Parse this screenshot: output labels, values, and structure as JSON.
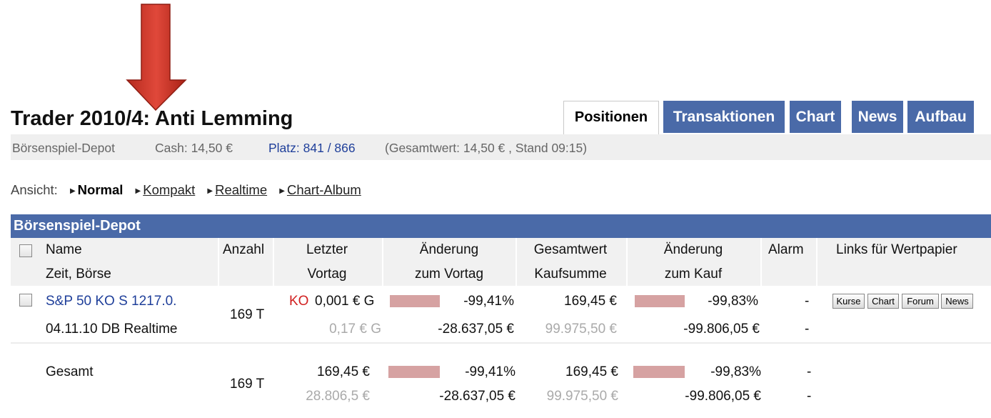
{
  "header": {
    "title": "Trader 2010/4: Anti Lemming",
    "tabs": [
      {
        "label": "Positionen",
        "active": true
      },
      {
        "label": "Transaktionen",
        "active": false
      },
      {
        "label": "Chart",
        "active": false
      },
      {
        "label": "News",
        "active": false
      },
      {
        "label": "Aufbau",
        "active": false
      }
    ]
  },
  "subbar": {
    "depot": "Börsenspiel-Depot",
    "cash": "Cash: 14,50 €",
    "platz": "Platz: 841 / 866",
    "gesamt": "(Gesamtwert: 14,50 € , Stand 09:15)"
  },
  "view": {
    "label": "Ansicht:",
    "options": [
      "Normal",
      "Kompakt",
      "Realtime",
      "Chart-Album"
    ],
    "selected": "Normal"
  },
  "table": {
    "title": "Börsenspiel-Depot",
    "headers": {
      "name": "Name",
      "zeit": "Zeit, Börse",
      "anzahl": "Anzahl",
      "letzter": "Letzter",
      "vortag": "Vortag",
      "aend_vortag_1": "Änderung",
      "aend_vortag_2": "zum Vortag",
      "gesamtwert": "Gesamtwert",
      "kaufsumme": "Kaufsumme",
      "aend_kauf_1": "Änderung",
      "aend_kauf_2": "zum Kauf",
      "alarm": "Alarm",
      "links": "Links für Wertpapier"
    },
    "position": {
      "name": "S&P 50 KO S 1217.0.",
      "zeit": "04.11.10 DB Realtime",
      "anzahl": "169 T",
      "ko": "KO",
      "letzter": "0,001 € G",
      "vortag": "0,17 € G",
      "aend_vortag_pct": "-99,41%",
      "aend_vortag_abs": "-28.637,05 €",
      "gesamtwert": "169,45 €",
      "kaufsumme": "99.975,50 €",
      "aend_kauf_pct": "-99,83%",
      "aend_kauf_abs": "-99.806,05 €",
      "alarm_1": "-",
      "alarm_2": "-",
      "links": [
        "Kurse",
        "Chart",
        "Forum",
        "News"
      ]
    },
    "total": {
      "label": "Gesamt",
      "anzahl": "169 T",
      "letzter": "169,45 €",
      "vortag": "28.806,5 €",
      "aend_vortag_pct": "-99,41%",
      "aend_vortag_abs": "-28.637,05 €",
      "gesamtwert": "169,45 €",
      "kaufsumme": "99.975,50 €",
      "aend_kauf_pct": "-99,83%",
      "aend_kauf_abs": "-99.806,05 €",
      "alarm_1": "-",
      "alarm_2": "-"
    }
  },
  "colors": {
    "accent": "#4a6aa8",
    "arrow": "#d13a2b",
    "bar": "#d6a2a2",
    "ko": "#d12020",
    "link": "#1f3f9a"
  }
}
